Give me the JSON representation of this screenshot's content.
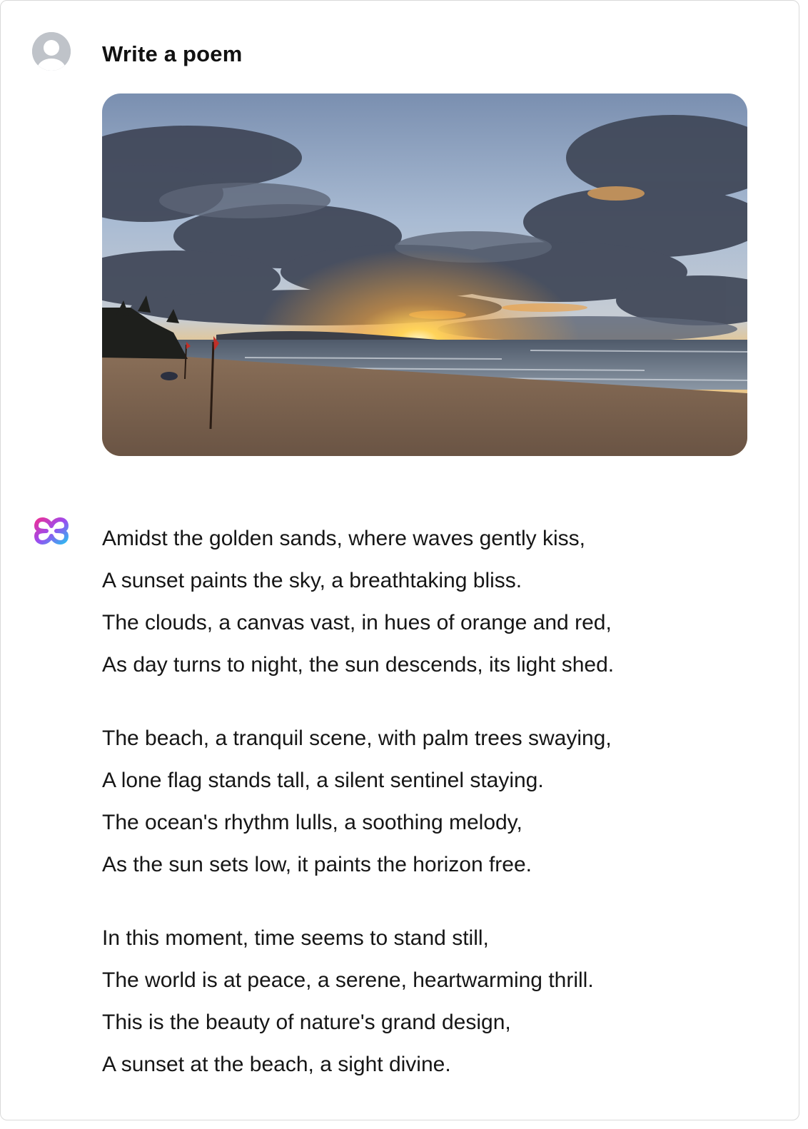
{
  "prompt": {
    "text": "Write a poem"
  },
  "photo": {
    "description_icon": "sunset-beach-photo"
  },
  "assistant": {
    "icon": "assistant-logo-icon"
  },
  "poem": {
    "stanzas": [
      {
        "lines": [
          "Amidst the golden sands, where waves gently kiss,",
          "A sunset paints the sky, a breathtaking bliss.",
          "The clouds, a canvas vast, in hues of orange and red,",
          "As day turns to night, the sun descends, its light shed."
        ]
      },
      {
        "lines": [
          "The beach, a tranquil scene, with palm trees swaying,",
          "A lone flag stands tall, a silent sentinel staying.",
          "The ocean's rhythm lulls, a soothing melody,",
          "As the sun sets low, it paints the horizon free."
        ]
      },
      {
        "lines": [
          "In this moment, time seems to stand still,",
          "The world is at peace, a serene, heartwarming thrill.",
          "This is the beauty of nature's grand design,",
          "A sunset at the beach, a sight divine."
        ]
      }
    ]
  },
  "colors": {
    "avatar": "#bfc3c9",
    "logo_pink": "#e8309a",
    "logo_blue": "#2fb8f0",
    "text": "#161616"
  }
}
